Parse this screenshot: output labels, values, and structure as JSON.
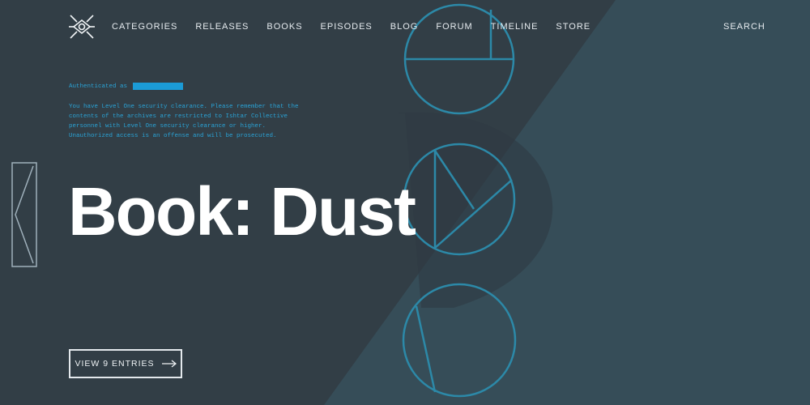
{
  "nav": {
    "items": [
      {
        "label": "CATEGORIES"
      },
      {
        "label": "RELEASES"
      },
      {
        "label": "BOOKS"
      },
      {
        "label": "EPISODES"
      },
      {
        "label": "BLOG"
      },
      {
        "label": "FORUM"
      },
      {
        "label": "TIMELINE"
      },
      {
        "label": "STORE"
      }
    ],
    "search_label": "SEARCH"
  },
  "auth": {
    "label": "Authenticated as"
  },
  "notice": {
    "lines": [
      "You have Level One security clearance. Please remember that the",
      "contents of the archives are restricted to Ishtar Collective",
      "personnel with Level One security clearance or higher.",
      "Unauthorized access is an offense and will be prosecuted."
    ]
  },
  "page_title": "Book: Dust",
  "cta": {
    "label": "VIEW 9 ENTRIES"
  },
  "icons": {
    "logo": "ishtar-collective-logo",
    "prev": "prev-arrow-icon",
    "cta_arrow": "arrow-right-icon"
  },
  "colors": {
    "background": "#323e46",
    "accent": "#2aa3d6",
    "text": "#ffffff"
  }
}
